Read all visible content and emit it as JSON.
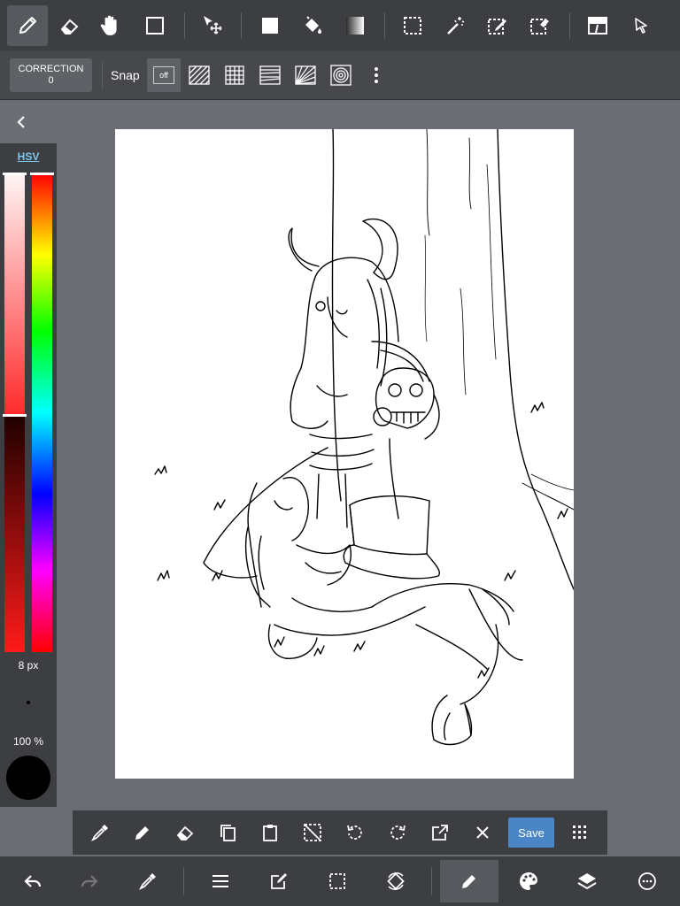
{
  "correction": {
    "label": "CORRECTION",
    "value": "0"
  },
  "snap": {
    "label": "Snap",
    "off_label": "off"
  },
  "color_panel": {
    "mode_label": "HSV",
    "brush_size": "8 px",
    "opacity": "100 %",
    "current_color": "#000000"
  },
  "actions": {
    "save_label": "Save"
  },
  "colors": {
    "accent": "#4a86c6",
    "toolbar_bg": "#3c3e42",
    "workspace_bg": "#6a6e74"
  }
}
